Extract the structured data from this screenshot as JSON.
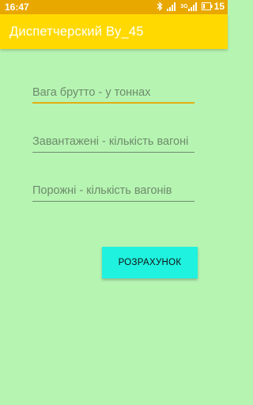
{
  "status_bar": {
    "time": "16:47",
    "network_label": "3G",
    "battery_level": "15",
    "icons": [
      "bluetooth-icon",
      "signal-icon",
      "signal-3g-icon",
      "battery-icon"
    ]
  },
  "app_bar": {
    "title": "Диспетчерский Ву_45",
    "color": "#ffd900"
  },
  "form": {
    "fields": [
      {
        "placeholder": "Вага брутто - у тоннах",
        "value": "",
        "focused": true
      },
      {
        "placeholder": "Завантажені - кількість вагоні",
        "value": ""
      },
      {
        "placeholder": "Порожні - кількість вагонів",
        "value": ""
      }
    ]
  },
  "actions": {
    "calculate_label": "РОЗРАХУНОК",
    "button_color": "#1ff2df"
  },
  "colors": {
    "background": "#b6f4b2",
    "status_bar": "#e9a800",
    "focused_underline": "#e1ae12"
  }
}
